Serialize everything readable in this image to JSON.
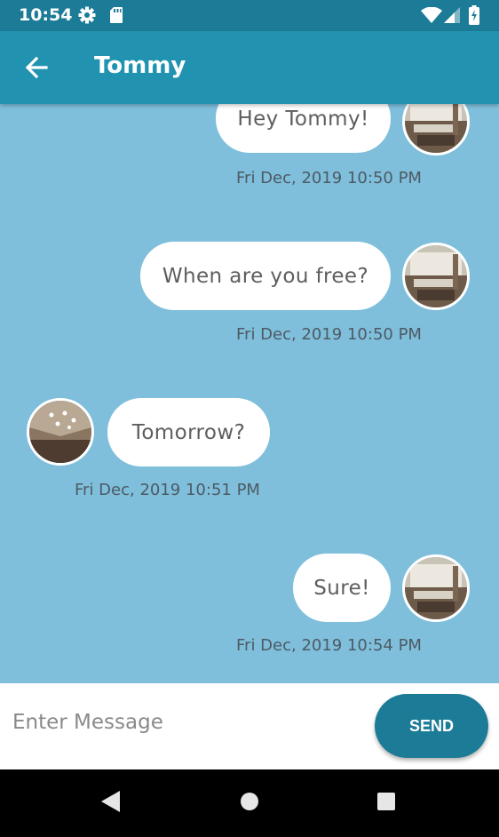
{
  "status_bar": {
    "time": "10:54"
  },
  "app_bar": {
    "title": "Tommy"
  },
  "messages": [
    {
      "sender": "self",
      "text": "Hey Tommy!",
      "timestamp": "Fri Dec, 2019 10:50 PM"
    },
    {
      "sender": "self",
      "text": "When are you free?",
      "timestamp": "Fri Dec, 2019 10:50 PM"
    },
    {
      "sender": "other",
      "text": "Tomorrow?",
      "timestamp": "Fri Dec, 2019 10:51 PM"
    },
    {
      "sender": "self",
      "text": "Sure!",
      "timestamp": "Fri Dec, 2019 10:54 PM"
    }
  ],
  "composer": {
    "placeholder": "Enter Message",
    "value": "",
    "send_label": "SEND"
  },
  "colors": {
    "status_bar": "#1c7b97",
    "app_bar": "#2193b0",
    "chat_background": "#7fbfdc",
    "send_button": "#1c7b97",
    "bubble": "#ffffff"
  }
}
